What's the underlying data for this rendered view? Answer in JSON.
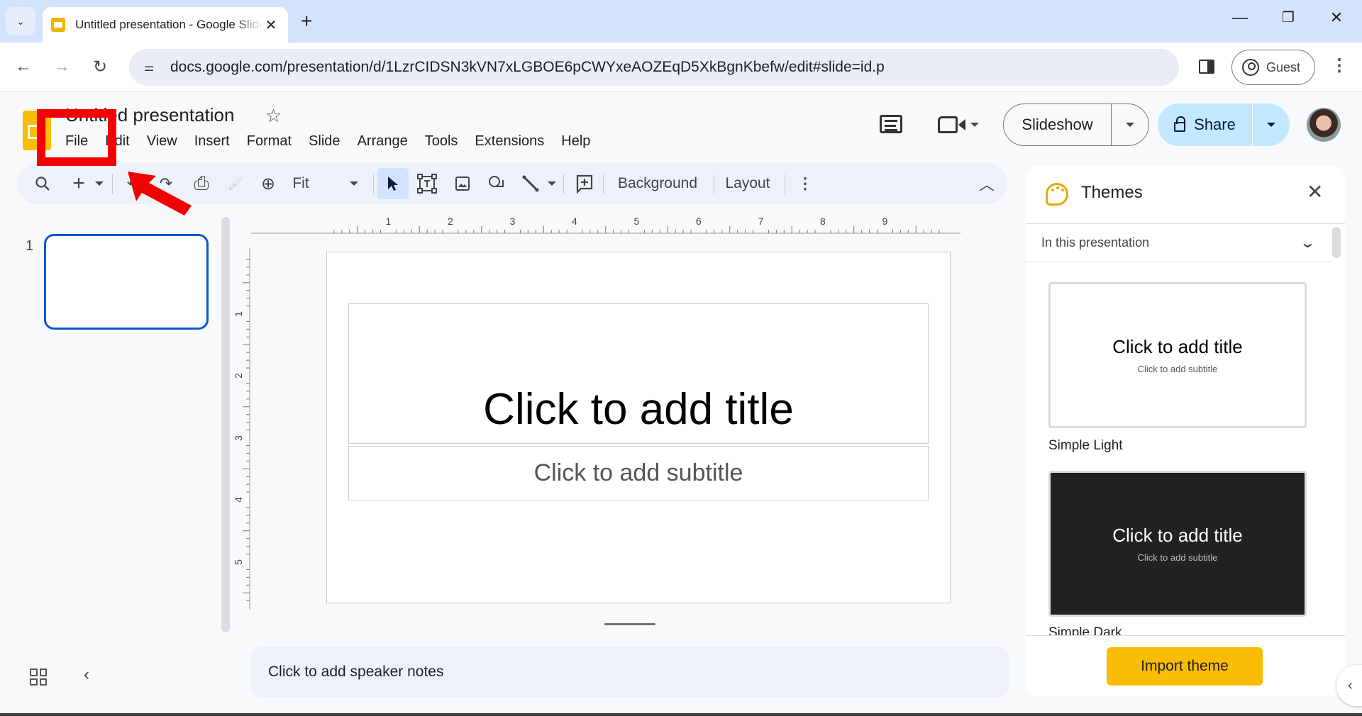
{
  "browser": {
    "tab_title": "Untitled presentation - Google Slides",
    "url": "docs.google.com/presentation/d/1LzrCIDSN3kVN7xLGBOE6pCWYxeAOZEqD5XkBgnKbefw/edit#slide=id.p",
    "profile_label": "Guest",
    "icons": {
      "tab_search": "chevron-down-icon",
      "new_tab": "plus-icon",
      "minimize": "minimize-icon",
      "restore": "restore-icon",
      "close": "close-icon",
      "back": "back-arrow-icon",
      "forward": "forward-arrow-icon",
      "reload": "reload-icon",
      "site_info": "tune-icon",
      "side_panel": "side-panel-icon",
      "menu": "more-vert-icon"
    }
  },
  "glyphs": {
    "chevron_down": "⌄",
    "close": "✕",
    "plus": "+",
    "minimize": "—",
    "restore": "❐",
    "back": "←",
    "forward": "→",
    "reload": "↻",
    "tune": "⚌",
    "more_vert": "⋮",
    "star": "☆",
    "search": "🔍",
    "undo": "↶",
    "redo": "↷",
    "print": "⎙",
    "paint": "🖌",
    "zoom": "⊕",
    "cursor": "➤",
    "textbox": "⌗",
    "image": "▣",
    "shape": "◯",
    "line": "╲",
    "comment_add": "⊞",
    "chevron_up": "︿",
    "chevron_left": "‹",
    "chevron_down_small": "⌄"
  },
  "docs": {
    "title": "Untitled presentation",
    "menu": [
      "File",
      "Edit",
      "View",
      "Insert",
      "Format",
      "Slide",
      "Arrange",
      "Tools",
      "Extensions",
      "Help"
    ],
    "slideshow_label": "Slideshow",
    "share_label": "Share",
    "toolbar": {
      "zoom_value": "Fit",
      "background_label": "Background",
      "layout_label": "Layout"
    }
  },
  "filmstrip": {
    "slides": [
      {
        "number": "1"
      }
    ]
  },
  "rulers": {
    "horizontal": [
      "1",
      "2",
      "3",
      "4",
      "5",
      "6",
      "7",
      "8",
      "9"
    ],
    "vertical": [
      "1",
      "2",
      "3",
      "4",
      "5"
    ]
  },
  "slide": {
    "title_placeholder": "Click to add title",
    "subtitle_placeholder": "Click to add subtitle"
  },
  "notes": {
    "placeholder": "Click to add speaker notes"
  },
  "themes_panel": {
    "title": "Themes",
    "filter": "In this presentation",
    "themes": [
      {
        "name": "Simple Light",
        "preview_title": "Click to add title",
        "preview_subtitle": "Click to add subtitle"
      },
      {
        "name": "Simple Dark",
        "preview_title": "Click to add title",
        "preview_subtitle": "Click to add subtitle"
      }
    ],
    "import_label": "Import theme"
  },
  "colors": {
    "accent_blue": "#0b57d0",
    "share_bg": "#c2e7ff",
    "import_btn": "#fbbc04",
    "annotation_red": "#f40000"
  }
}
